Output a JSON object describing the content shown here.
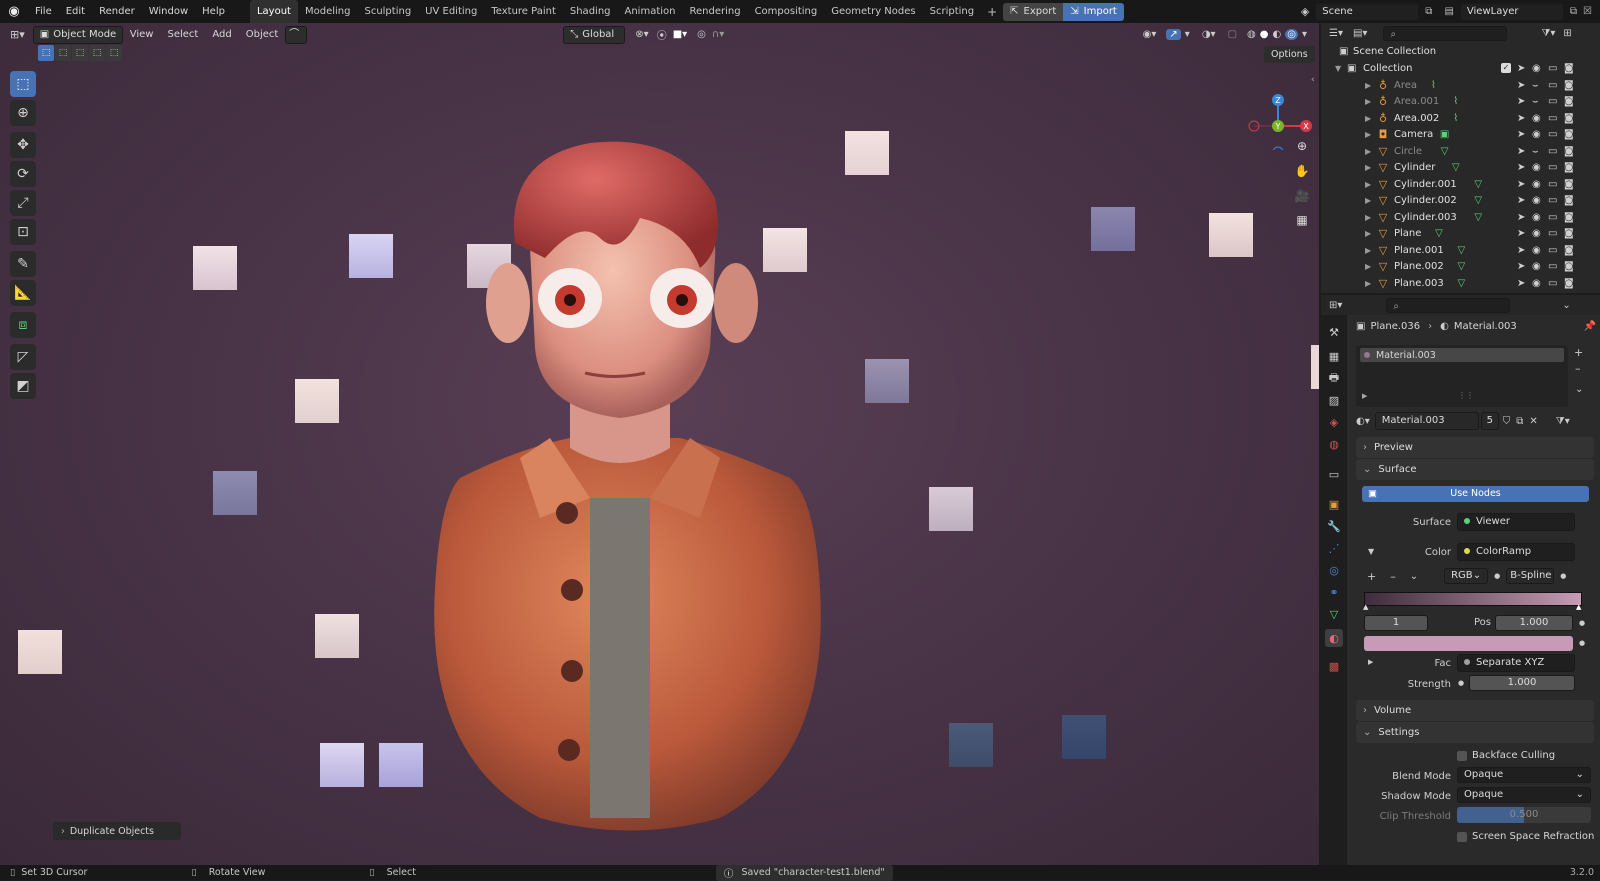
{
  "topbar": {
    "menus": [
      "File",
      "Edit",
      "Render",
      "Window",
      "Help"
    ],
    "workspaces": [
      "Layout",
      "Modeling",
      "Sculpting",
      "UV Editing",
      "Texture Paint",
      "Shading",
      "Animation",
      "Rendering",
      "Compositing",
      "Geometry Nodes",
      "Scripting"
    ],
    "active_workspace": "Layout",
    "export_label": "Export",
    "import_label": "Import",
    "scene_name": "Scene",
    "view_layer": "ViewLayer"
  },
  "viewport_header": {
    "mode": "Object Mode",
    "menus": [
      "View",
      "Select",
      "Add",
      "Object"
    ],
    "transform_orientation": "Global",
    "options_label": "Options"
  },
  "last_operator": "Duplicate Objects",
  "outliner": {
    "root": "Scene Collection",
    "collection": "Collection",
    "items": [
      {
        "name": "Area",
        "icon": "light-icon",
        "dim": true
      },
      {
        "name": "Area.001",
        "icon": "light-icon",
        "dim": true
      },
      {
        "name": "Area.002",
        "icon": "light-icon",
        "dim": false
      },
      {
        "name": "Camera",
        "icon": "camera-icon",
        "dim": false
      },
      {
        "name": "Circle",
        "icon": "mesh-icon",
        "dim": true
      },
      {
        "name": "Cylinder",
        "icon": "mesh-icon",
        "dim": false
      },
      {
        "name": "Cylinder.001",
        "icon": "mesh-icon",
        "dim": false
      },
      {
        "name": "Cylinder.002",
        "icon": "mesh-icon",
        "dim": false
      },
      {
        "name": "Cylinder.003",
        "icon": "mesh-icon",
        "dim": false
      },
      {
        "name": "Plane",
        "icon": "mesh-icon",
        "dim": false
      },
      {
        "name": "Plane.001",
        "icon": "mesh-icon",
        "dim": false
      },
      {
        "name": "Plane.002",
        "icon": "mesh-icon",
        "dim": false
      },
      {
        "name": "Plane.003",
        "icon": "mesh-icon",
        "dim": false
      }
    ]
  },
  "properties": {
    "breadcrumb_object": "Plane.036",
    "breadcrumb_material": "Material.003",
    "slot_name": "Material.003",
    "material_name": "Material.003",
    "user_count": "5",
    "preview_label": "Preview",
    "surface_label": "Surface",
    "use_nodes_label": "Use Nodes",
    "surface_field_label": "Surface",
    "surface_value": "Viewer",
    "color_label": "Color",
    "color_value": "ColorRamp",
    "color_mode": "RGB",
    "interpolation": "B-Spline",
    "stop_index": "1",
    "pos_label": "Pos",
    "pos_value": "1.000",
    "ramp_color": "#c79bb5",
    "fac_label": "Fac",
    "fac_value": "Separate XYZ",
    "strength_label": "Strength",
    "strength_value": "1.000",
    "volume_label": "Volume",
    "settings_label": "Settings",
    "backface_culling": "Backface Culling",
    "blend_mode_label": "Blend Mode",
    "blend_mode": "Opaque",
    "shadow_mode_label": "Shadow Mode",
    "shadow_mode": "Opaque",
    "clip_threshold_label": "Clip Threshold",
    "clip_threshold": "0.500",
    "clip_threshold_fraction": 0.5,
    "screen_space_refraction": "Screen Space Refraction"
  },
  "statusbar": {
    "hint1": "Set 3D Cursor",
    "hint2": "Rotate View",
    "hint3": "Select",
    "message": "Saved \"character-test1.blend\"",
    "version": "3.2.0"
  },
  "colors": {
    "accent": "#4772b3",
    "viewport_bg": "#4a3448"
  }
}
